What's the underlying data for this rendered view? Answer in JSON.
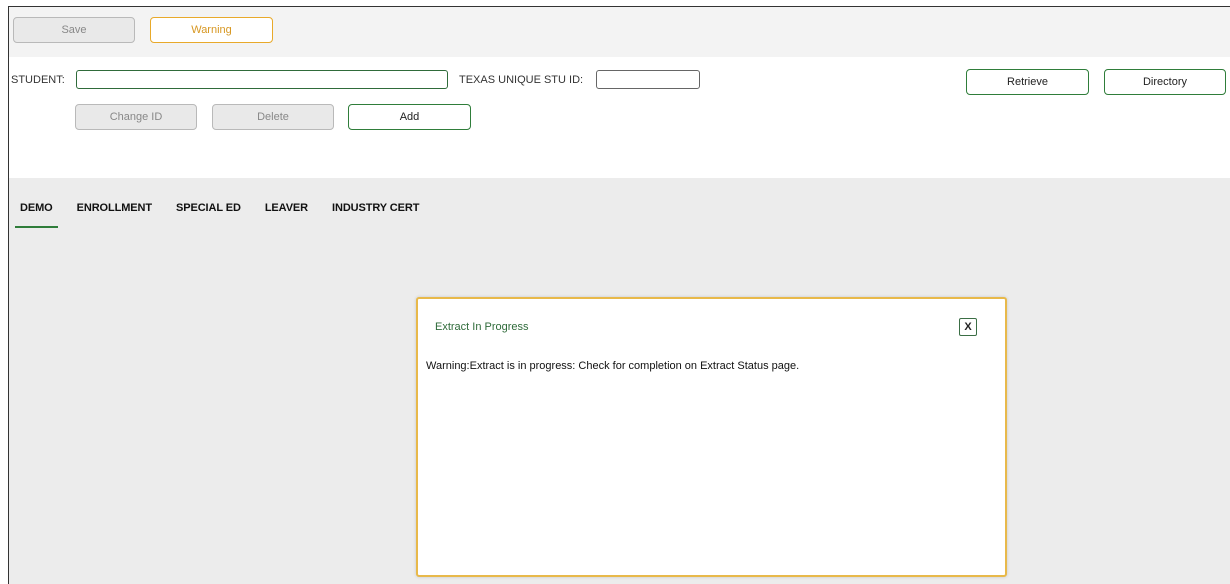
{
  "toolbar": {
    "save_label": "Save",
    "warning_label": "Warning"
  },
  "form": {
    "student_label": "STUDENT:",
    "student_value": "",
    "texas_label": "TEXAS UNIQUE STU ID:",
    "texas_value": "",
    "retrieve_label": "Retrieve",
    "directory_label": "Directory",
    "change_id_label": "Change ID",
    "delete_label": "Delete",
    "add_label": "Add"
  },
  "tabs": [
    {
      "label": "DEMO",
      "active": true
    },
    {
      "label": "ENROLLMENT",
      "active": false
    },
    {
      "label": "SPECIAL ED",
      "active": false
    },
    {
      "label": "LEAVER",
      "active": false
    },
    {
      "label": "INDUSTRY CERT",
      "active": false
    }
  ],
  "modal": {
    "title": "Extract In Progress",
    "close_label": "X",
    "message": "Warning:Extract is in progress: Check for completion on Extract Status page."
  },
  "colors": {
    "accent_green": "#2f7d3a",
    "warning_orange": "#e8a92a",
    "modal_border": "#e8b94a",
    "content_background": "#ececec"
  }
}
